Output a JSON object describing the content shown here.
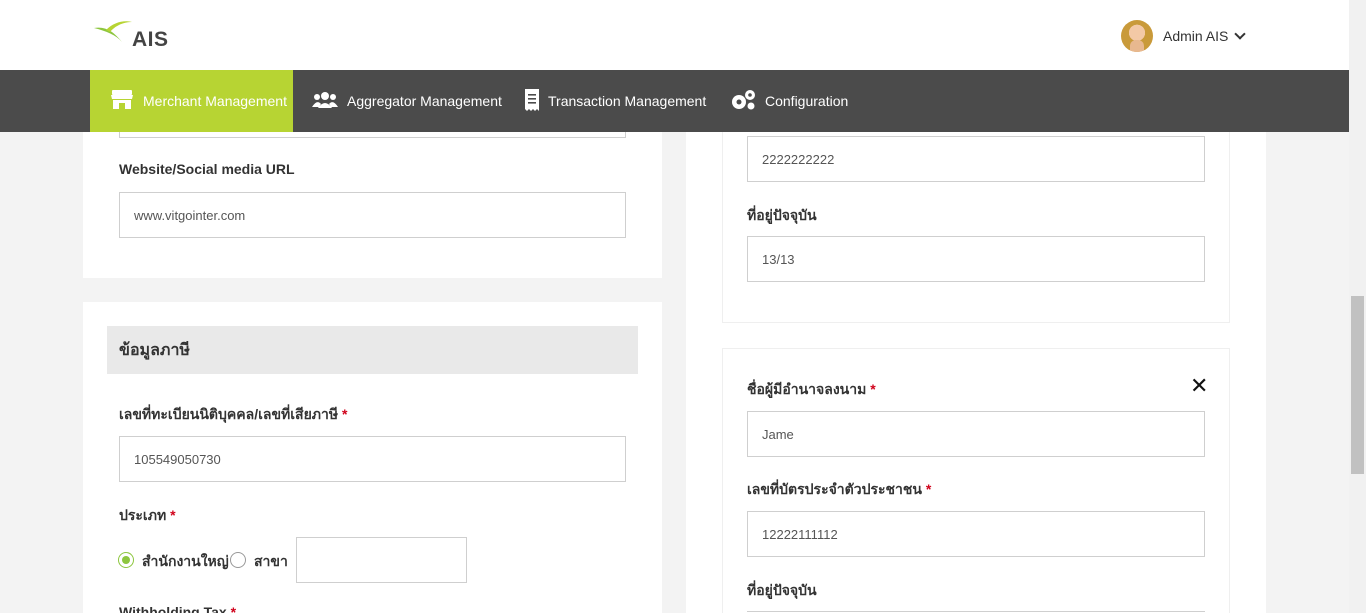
{
  "brand": {
    "logo_text": "AIS",
    "accent_color": "#b7d433"
  },
  "user": {
    "name": "Admin AIS"
  },
  "nav": {
    "items": [
      {
        "label": "Merchant Management",
        "icon": "store-icon",
        "active": true
      },
      {
        "label": "Aggregator Management",
        "icon": "users-icon",
        "active": false
      },
      {
        "label": "Transaction Management",
        "icon": "receipt-icon",
        "active": false
      },
      {
        "label": "Configuration",
        "icon": "gears-icon",
        "active": false
      }
    ]
  },
  "left": {
    "website_label": "Website/Social media URL",
    "website_value": "www.vitgointer.com",
    "tax_section_title": "ข้อมูลภาษี",
    "tax_id_label": "เลขที่ทะเบียนนิติบุคคล/เลขที่เสียภาษี",
    "tax_id_value": "105549050730",
    "type_label": "ประเภท",
    "type_options": [
      "สำนักงานใหญ่",
      "สาขา"
    ],
    "type_selected": "สำนักงานใหญ่",
    "branch_value": "",
    "withholding_label": "Withholding Tax",
    "required_mark": "*"
  },
  "right": {
    "phone_value": "2222222222",
    "address_label": "ที่อยู่ปัจจุบัน",
    "address_value": "13/13",
    "signer_label": "ชื่อผู้มีอำนาจลงนาม",
    "signer_value": "Jame",
    "id_card_label": "เลขที่บัตรประจำตัวประชาชน",
    "id_card_value": "12222111112",
    "address2_label": "ที่อยู่ปัจจุบัน",
    "close_label": "✕"
  }
}
